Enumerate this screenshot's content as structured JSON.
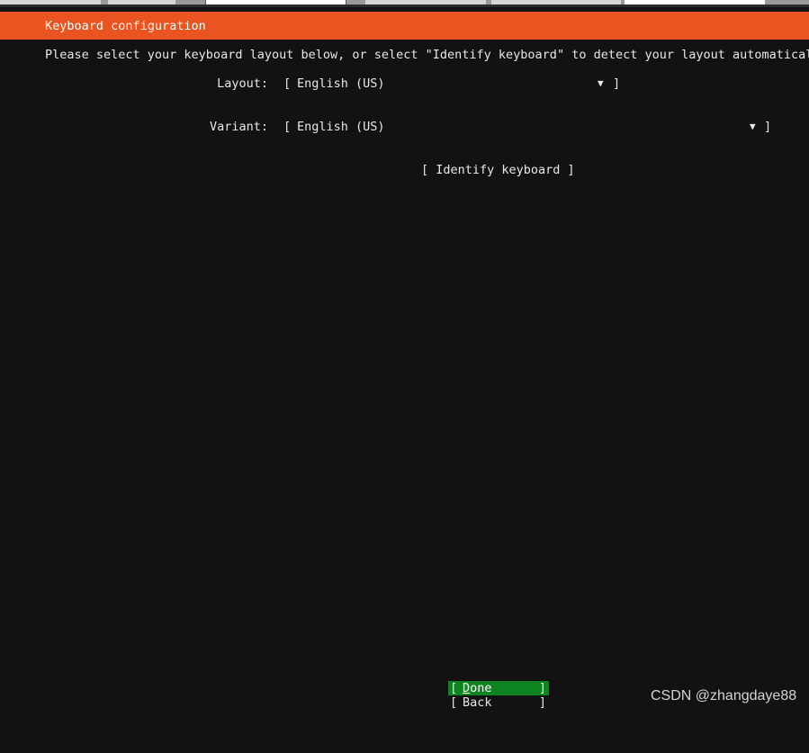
{
  "header": {
    "title": "Keyboard configuration"
  },
  "instructions": "Please select your keyboard layout below, or select \"Identify keyboard\" to detect your layout automaticall",
  "layout": {
    "label": "Layout:",
    "bracket_open": "[",
    "value": "English (US)",
    "arrow": "▼",
    "bracket_close": "]"
  },
  "variant": {
    "label": "Variant:",
    "bracket_open": "[",
    "value": "English (US)",
    "arrow": "▼",
    "bracket_close": "]"
  },
  "identify_button": "[ Identify keyboard ]",
  "buttons": {
    "done": {
      "open": "[",
      "label_first": "D",
      "label_rest": "one",
      "close": "]"
    },
    "back": {
      "open": "[",
      "label": "Back",
      "close": "]"
    }
  },
  "watermark": "CSDN @zhangdaye88",
  "colors": {
    "accent": "#e95420",
    "selected_button": "#0e8420",
    "background": "#121212"
  }
}
